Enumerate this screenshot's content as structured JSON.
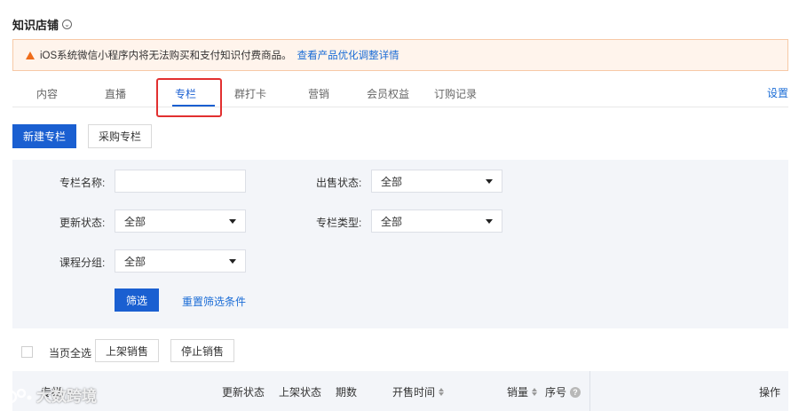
{
  "header": {
    "title": "知识店铺",
    "title_icon": "chevron-down-circle-icon"
  },
  "notice": {
    "text": "iOS系统微信小程序内将无法购买和支付知识付费商品。",
    "link": "查看产品优化调整详情",
    "icon": "warning-triangle-icon",
    "accent": "#ef6c1a"
  },
  "tabs": [
    {
      "label": "内容"
    },
    {
      "label": "直播"
    },
    {
      "label": "专栏",
      "active": true
    },
    {
      "label": "群打卡"
    },
    {
      "label": "营销"
    },
    {
      "label": "会员权益"
    },
    {
      "label": "订购记录"
    }
  ],
  "settings_label": "设置",
  "actions": {
    "new_label": "新建专栏",
    "purchase_label": "采购专栏"
  },
  "filters": {
    "name_label": "专栏名称:",
    "name_value": "",
    "sale_status_label": "出售状态:",
    "sale_status_value": "全部",
    "update_status_label": "更新状态:",
    "update_status_value": "全部",
    "type_label": "专栏类型:",
    "type_value": "全部",
    "group_label": "课程分组:",
    "group_value": "全部",
    "filter_button": "筛选",
    "reset_link": "重置筛选条件"
  },
  "bulk": {
    "select_all": "当页全选",
    "list_button": "上架销售",
    "stop_button": "停止销售"
  },
  "table": {
    "columns": [
      "专栏",
      "更新状态",
      "上架状态",
      "期数",
      "开售时间",
      "销量",
      "序号",
      "操作"
    ]
  },
  "watermark": {
    "text": "大数跨境"
  },
  "colors": {
    "primary": "#1a5fd1",
    "link": "#1a6cd6",
    "highlight": "#e23030",
    "panel": "#f3f5f9"
  }
}
